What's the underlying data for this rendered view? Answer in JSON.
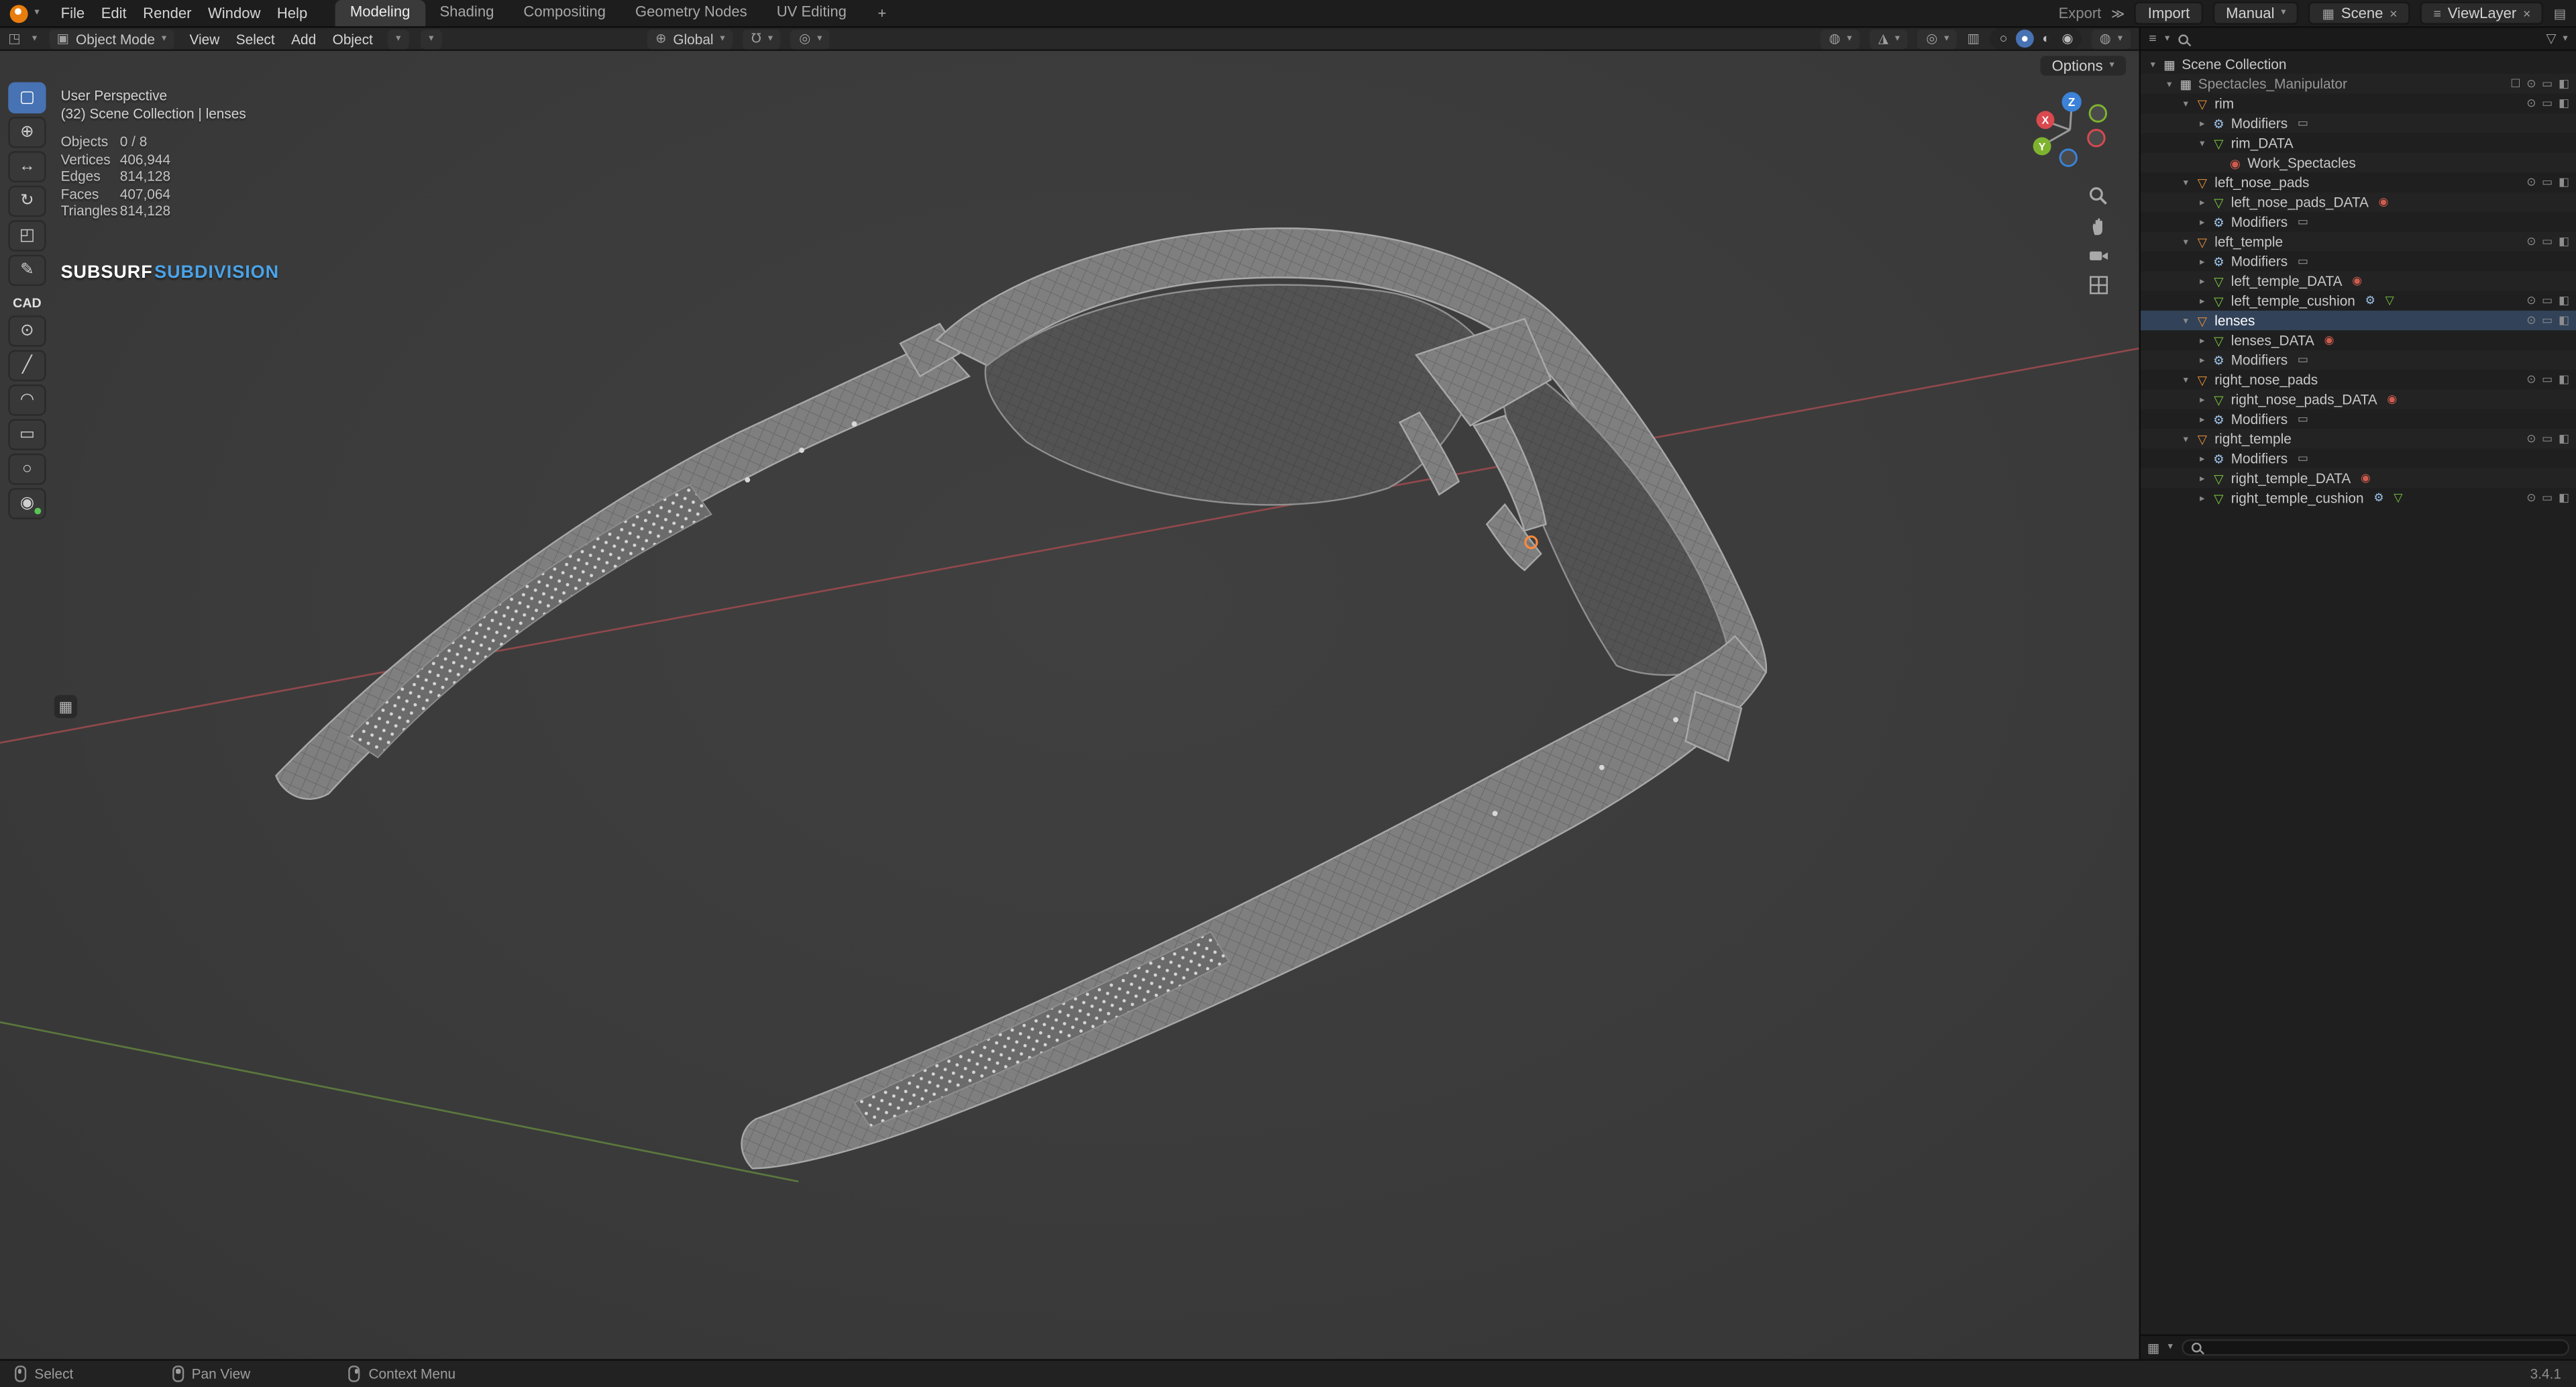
{
  "topbar": {
    "menus": [
      "File",
      "Edit",
      "Render",
      "Window",
      "Help"
    ],
    "workspaces": [
      {
        "label": "Modeling",
        "active": true
      },
      {
        "label": "Shading",
        "active": false
      },
      {
        "label": "Compositing",
        "active": false
      },
      {
        "label": "Geometry Nodes",
        "active": false
      },
      {
        "label": "UV Editing",
        "active": false
      }
    ],
    "new_workspace": "+",
    "export_label": "Export",
    "import_label": "Import",
    "manual_label": "Manual",
    "scene_label": "Scene",
    "viewlayer_label": "ViewLayer"
  },
  "viewport_header": {
    "mode": "Object Mode",
    "menus": [
      "View",
      "Select",
      "Add",
      "Object"
    ],
    "orientation": "Global",
    "options_label": "Options"
  },
  "overlay": {
    "view": "User Perspective",
    "context": "(32) Scene Collection | lenses",
    "stats": [
      {
        "label": "Objects",
        "value": "0 / 8"
      },
      {
        "label": "Vertices",
        "value": "406,944"
      },
      {
        "label": "Edges",
        "value": "814,128"
      },
      {
        "label": "Faces",
        "value": "407,064"
      },
      {
        "label": "Triangles",
        "value": "814,128"
      }
    ],
    "modifier_left": "SUBSURF",
    "modifier_right": "SUBDIVISION"
  },
  "gizmo": {
    "axes": [
      "X",
      "Y",
      "Z"
    ]
  },
  "toolbar": {
    "tools": [
      {
        "name": "select-box",
        "active": true
      },
      {
        "name": "cursor",
        "active": false
      },
      {
        "name": "move",
        "active": false
      },
      {
        "name": "rotate",
        "active": false
      },
      {
        "name": "transform",
        "active": false
      },
      {
        "name": "annotate",
        "active": false
      }
    ],
    "cad_label": "CAD",
    "cad_tools": [
      {
        "name": "cad-point"
      },
      {
        "name": "cad-line"
      },
      {
        "name": "cad-arc"
      },
      {
        "name": "cad-rectangle"
      },
      {
        "name": "cad-circle"
      },
      {
        "name": "cad-gizmo",
        "dot": true
      }
    ]
  },
  "outliner": {
    "rows": [
      {
        "label": "Scene Collection",
        "depth": 0,
        "icon": "collection",
        "arrow": "down",
        "vis": []
      },
      {
        "label": "Spectacles_Manipulator",
        "depth": 1,
        "icon": "collection",
        "arrow": "down",
        "dim": true,
        "vis": [
          "checkbox",
          "eye",
          "monitor",
          "camera"
        ]
      },
      {
        "label": "rim",
        "depth": 2,
        "icon": "object",
        "arrow": "down",
        "vis": [
          "eye",
          "monitor",
          "camera"
        ]
      },
      {
        "label": "Modifiers",
        "depth": 3,
        "icon": "wrench",
        "arrow": "right",
        "badges": [
          "screen"
        ],
        "vis": []
      },
      {
        "label": "rim_DATA",
        "depth": 3,
        "icon": "mesh",
        "arrow": "down",
        "vis": []
      },
      {
        "label": "Work_Spectacles",
        "depth": 4,
        "icon": "material",
        "arrow": "none",
        "vis": []
      },
      {
        "label": "left_nose_pads",
        "depth": 2,
        "icon": "object",
        "arrow": "down",
        "vis": [
          "eye",
          "monitor",
          "camera"
        ]
      },
      {
        "label": "left_nose_pads_DATA",
        "depth": 3,
        "icon": "mesh",
        "arrow": "right",
        "badges": [
          "material"
        ],
        "vis": []
      },
      {
        "label": "Modifiers",
        "depth": 3,
        "icon": "wrench",
        "arrow": "right",
        "badges": [
          "screen"
        ],
        "vis": []
      },
      {
        "label": "left_temple",
        "depth": 2,
        "icon": "object",
        "arrow": "down",
        "vis": [
          "eye",
          "monitor",
          "camera"
        ]
      },
      {
        "label": "Modifiers",
        "depth": 3,
        "icon": "wrench",
        "arrow": "right",
        "badges": [
          "screen"
        ],
        "vis": []
      },
      {
        "label": "left_temple_DATA",
        "depth": 3,
        "icon": "mesh",
        "arrow": "right",
        "badges": [
          "material"
        ],
        "vis": []
      },
      {
        "label": "left_temple_cushion",
        "depth": 3,
        "icon": "mesh",
        "arrow": "right",
        "badges": [
          "wrench",
          "mesh"
        ],
        "vis": [
          "eye",
          "monitor",
          "camera"
        ]
      },
      {
        "label": "lenses",
        "depth": 2,
        "icon": "object",
        "arrow": "down",
        "selected": true,
        "vis": [
          "eye",
          "monitor",
          "camera"
        ]
      },
      {
        "label": "lenses_DATA",
        "depth": 3,
        "icon": "mesh",
        "arrow": "right",
        "badges": [
          "material"
        ],
        "vis": []
      },
      {
        "label": "Modifiers",
        "depth": 3,
        "icon": "wrench",
        "arrow": "right",
        "badges": [
          "screen"
        ],
        "vis": []
      },
      {
        "label": "right_nose_pads",
        "depth": 2,
        "icon": "object",
        "arrow": "down",
        "vis": [
          "eye",
          "monitor",
          "camera"
        ]
      },
      {
        "label": "right_nose_pads_DATA",
        "depth": 3,
        "icon": "mesh",
        "arrow": "right",
        "badges": [
          "material"
        ],
        "vis": []
      },
      {
        "label": "Modifiers",
        "depth": 3,
        "icon": "wrench",
        "arrow": "right",
        "badges": [
          "screen"
        ],
        "vis": []
      },
      {
        "label": "right_temple",
        "depth": 2,
        "icon": "object",
        "arrow": "down",
        "vis": [
          "eye",
          "monitor",
          "camera"
        ]
      },
      {
        "label": "Modifiers",
        "depth": 3,
        "icon": "wrench",
        "arrow": "right",
        "badges": [
          "screen"
        ],
        "vis": []
      },
      {
        "label": "right_temple_DATA",
        "depth": 3,
        "icon": "mesh",
        "arrow": "right",
        "badges": [
          "material"
        ],
        "vis": []
      },
      {
        "label": "right_temple_cushion",
        "depth": 3,
        "icon": "mesh",
        "arrow": "right",
        "badges": [
          "wrench",
          "mesh"
        ],
        "vis": [
          "eye",
          "monitor",
          "camera"
        ]
      }
    ]
  },
  "statusbar": {
    "items": [
      "Select",
      "Pan View",
      "Context Menu"
    ],
    "version": "3.4.1"
  },
  "colors": {
    "accent": "#4772b3",
    "object_icon": "#e8923c",
    "mesh_icon": "#7ecb3f",
    "modifier_icon": "#9ec3e8",
    "material_icon": "#cf5c4e",
    "subdivision_blue": "#4aa3e8",
    "axis_x": "#d9494f",
    "axis_y": "#7eb32f",
    "axis_z": "#3b82d8"
  }
}
